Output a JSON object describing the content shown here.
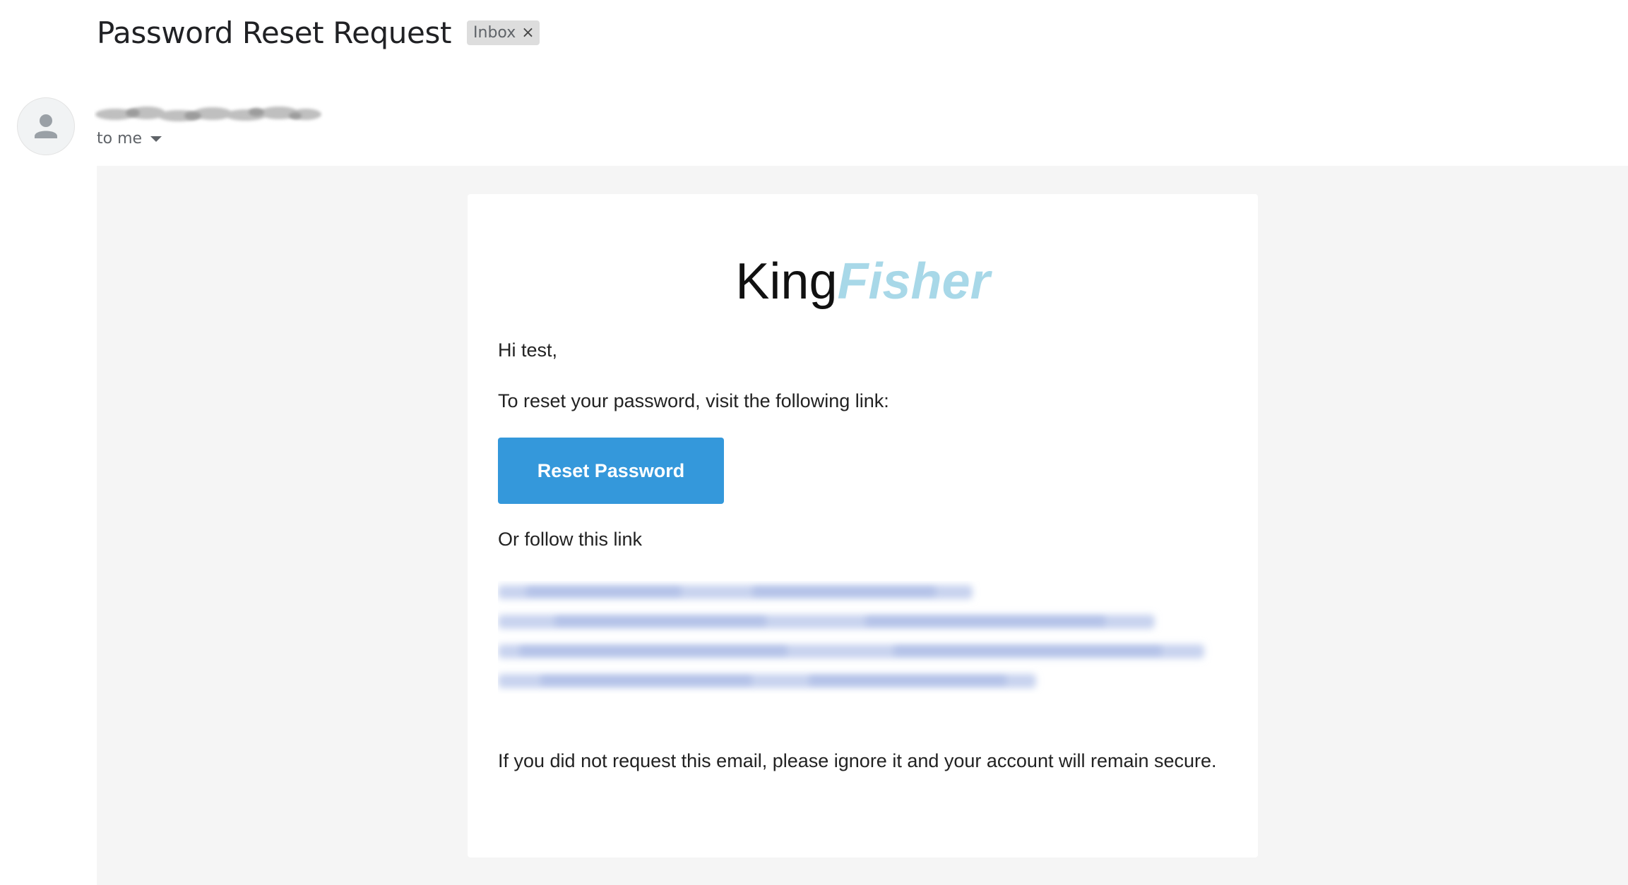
{
  "email": {
    "subject": "Password Reset Request",
    "label": "Inbox",
    "label_remove": "×",
    "recipient": "to me"
  },
  "message": {
    "logo_part1": "King",
    "logo_part2": "Fisher",
    "greeting": "Hi test,",
    "instruction": "To reset your password, visit the following link:",
    "button_label": "Reset Password",
    "alt_text": "Or follow this link",
    "footer": "If you did not request this email, please ignore it and your account will remain secure."
  },
  "colors": {
    "button": "#3498db",
    "logo_accent": "#a8d8e8",
    "body_background": "#f5f5f5",
    "link": "#1a73e8"
  },
  "icons": {
    "avatar": "person-icon",
    "dropdown": "caret-down-icon",
    "remove_label": "close-icon"
  }
}
